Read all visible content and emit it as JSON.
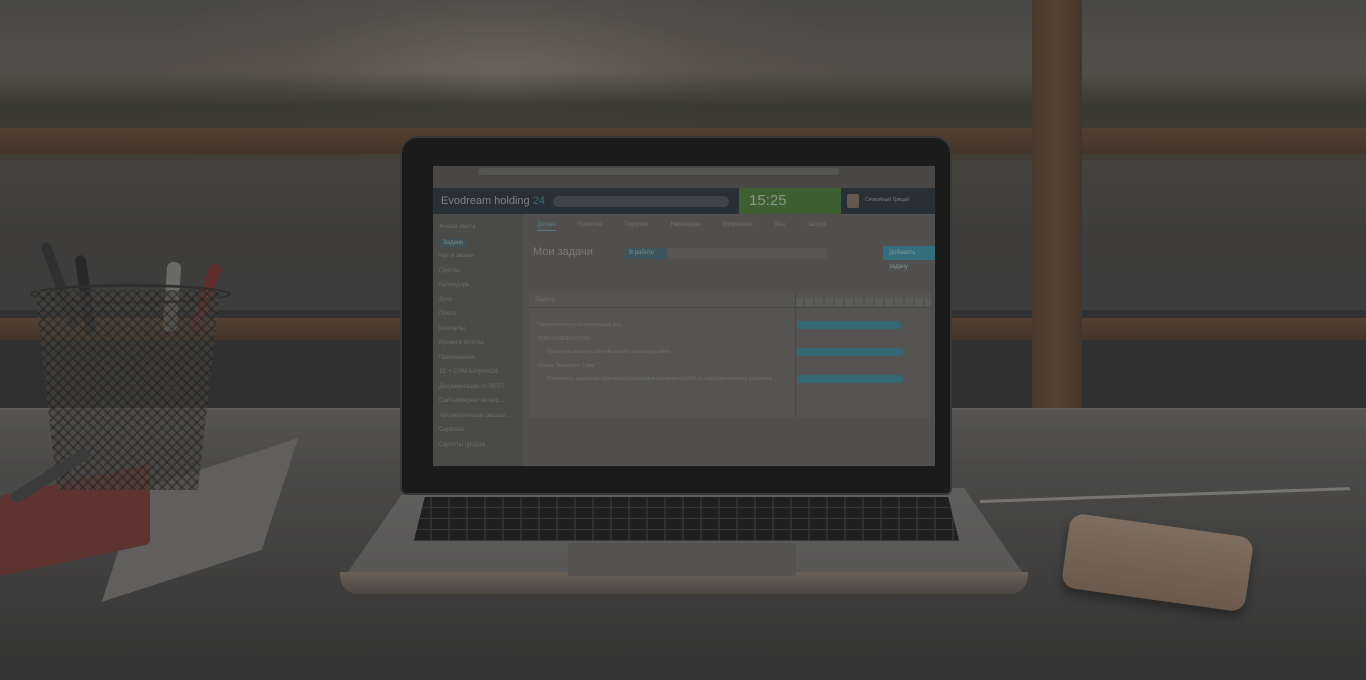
{
  "screen": {
    "brand": "Evodream holding",
    "brand_suffix": "24",
    "clock": "15:25",
    "user_name": "Спокойный Грицай",
    "page_title": "Мои задачи",
    "filter_label": "В работе",
    "add_button": "Добавить задачу",
    "tabs": [
      "Делаю",
      "Помогаю",
      "Поручил",
      "Наблюдаю",
      "Избранное",
      "Все",
      "Запуск"
    ],
    "sidebar": [
      "Живая лента",
      "Задачи",
      "Чат и звонки",
      "Группы",
      "Календарь",
      "Диск",
      "Почта",
      "Контакты",
      "Время и отчеты",
      "Приложения",
      "1С + CRM Битрикс24",
      "Документация по REST",
      "Сайты/Маркет интегр...",
      "Автоматические рассыл...",
      "Сервисы",
      "Скрипты продаж"
    ],
    "gantt_header": "Задача",
    "tasks": [
      {
        "label": "Привести отчеты в нормальный вид",
        "indent": false
      },
      {
        "label": "ТИРАЖИ/ДОРАБОТКИ",
        "indent": false
      },
      {
        "label": "Проверить верстку сайта Aracea по эскизам дизайна",
        "indent": true
      },
      {
        "label": "Общие \"Маркетинг Тайм\"",
        "indent": false
      },
      {
        "label": "Посмотреть видео про триггерные рассылки и настроить в ЦРМ по статусам отправку шаблонов",
        "indent": true
      }
    ]
  }
}
